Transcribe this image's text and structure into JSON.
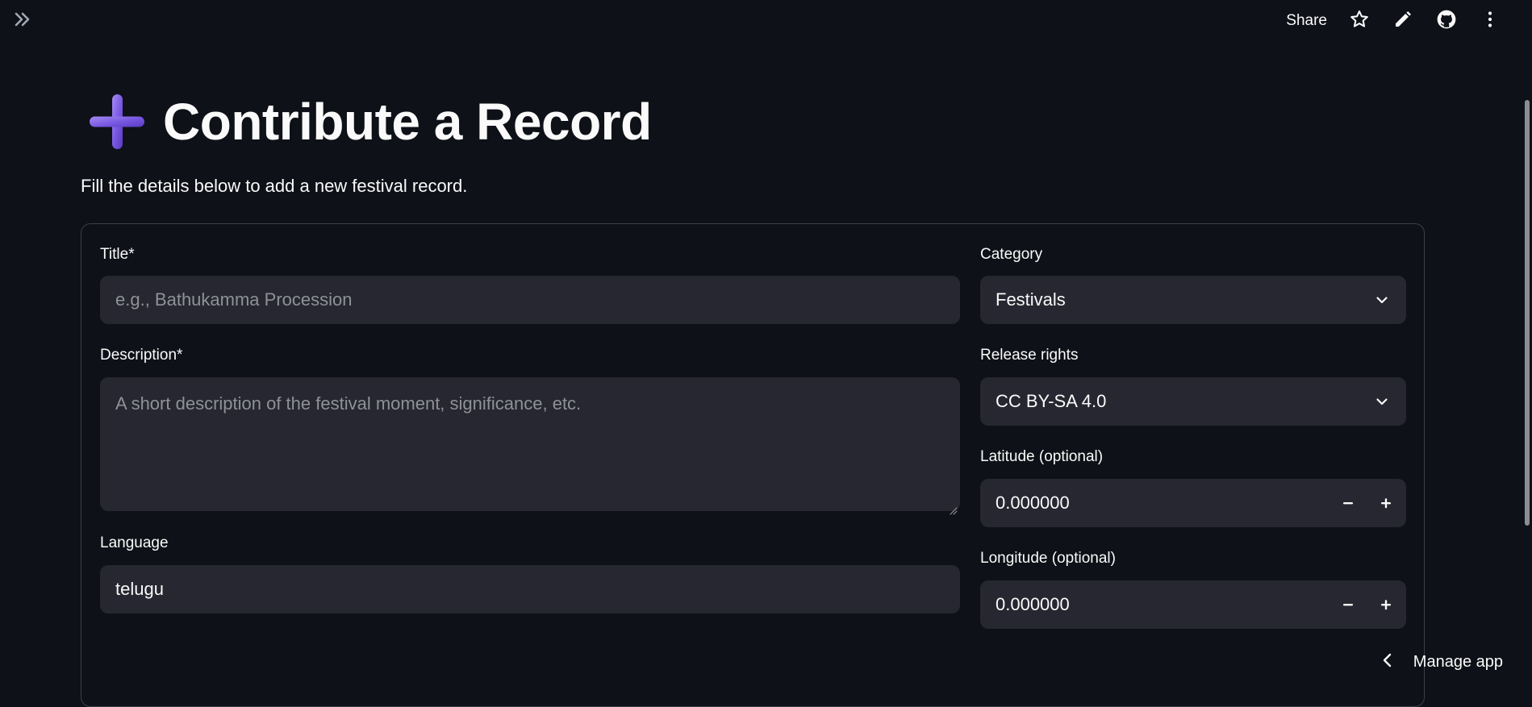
{
  "header": {
    "share_label": "Share",
    "icons": [
      "double-chevron-right-icon",
      "star-icon",
      "pencil-icon",
      "github-icon",
      "more-vertical-icon"
    ]
  },
  "main": {
    "title_emoji": "heavy-plus-sign",
    "title": "Contribute a Record",
    "subtitle": "Fill the details below to add a new festival record."
  },
  "form": {
    "title": {
      "label": "Title*",
      "value": "",
      "placeholder": "e.g., Bathukamma Procession"
    },
    "description": {
      "label": "Description*",
      "value": "",
      "placeholder": "A short description of the festival moment, significance, etc."
    },
    "language": {
      "label": "Language",
      "value": "telugu"
    },
    "category": {
      "label": "Category",
      "value": "Festivals"
    },
    "release_rights": {
      "label": "Release rights",
      "value": "CC BY-SA 4.0"
    },
    "latitude": {
      "label": "Latitude (optional)",
      "value": "0.000000"
    },
    "longitude": {
      "label": "Longitude (optional)",
      "value": "0.000000"
    }
  },
  "footer": {
    "manage_app_label": "Manage app"
  },
  "colors": {
    "background": "#0e1117",
    "input_background": "#262730",
    "border": "#3d3f48",
    "placeholder": "#8f9198",
    "text": "#fafafa",
    "accent_purple": "#7b5ee0"
  }
}
